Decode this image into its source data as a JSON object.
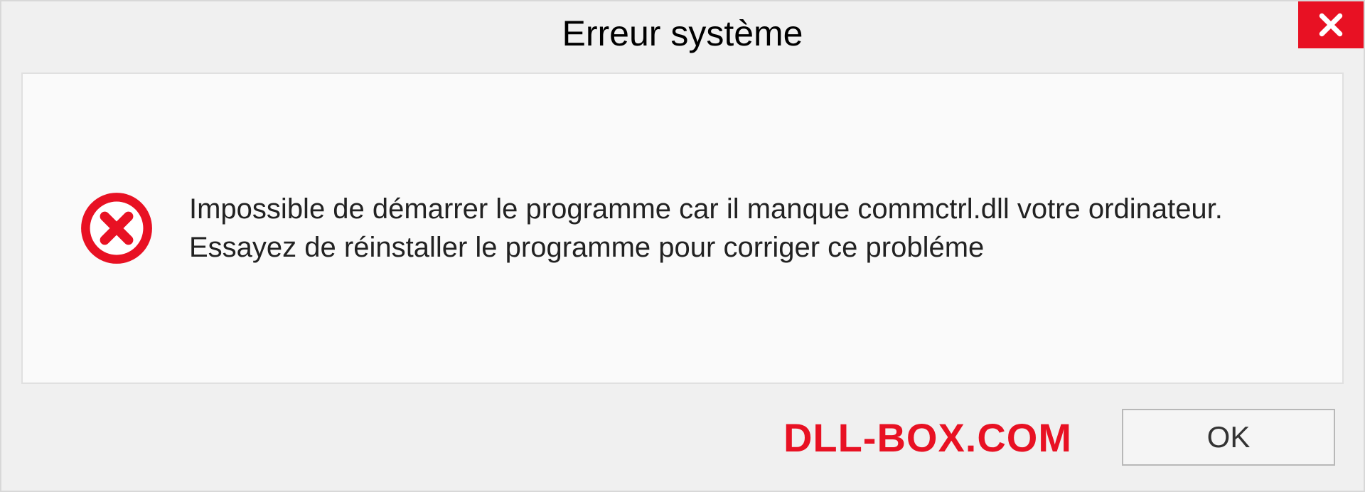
{
  "dialog": {
    "title": "Erreur système",
    "message": "Impossible de démarrer le programme car il manque commctrl.dll votre ordinateur. Essayez de réinstaller le programme pour corriger ce probléme",
    "watermark": "DLL-BOX.COM",
    "ok_label": "OK",
    "colors": {
      "accent_red": "#e81123",
      "background": "#f0f0f0",
      "content_bg": "#fafafa"
    },
    "icons": {
      "close": "close-icon",
      "error": "error-icon"
    }
  }
}
